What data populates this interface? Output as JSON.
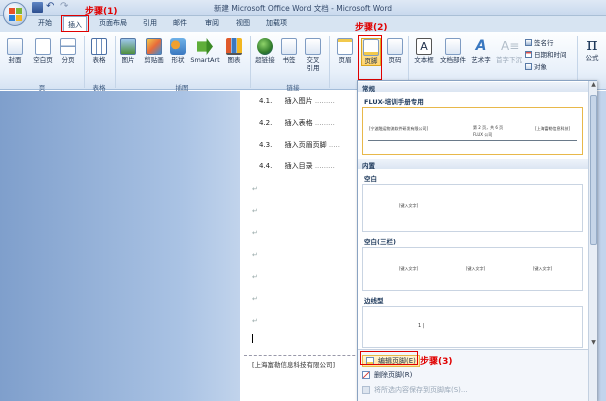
{
  "window": {
    "title": "新建 Microsoft Office Word 文档 - Microsoft Word"
  },
  "tabs": [
    "开始",
    "插入",
    "页面布局",
    "引用",
    "邮件",
    "审阅",
    "视图",
    "加载项"
  ],
  "active_tab": "插入",
  "annotations": {
    "step1": "步骤(1)",
    "step2": "步骤(2)",
    "step3": "步骤(3)"
  },
  "ribbon": {
    "pages": {
      "cover": "封面",
      "blank": "空白页",
      "break": "分页",
      "label": "页"
    },
    "tables": {
      "table": "表格",
      "label": "表格"
    },
    "illustrations": {
      "picture": "图片",
      "clipart": "剪贴画",
      "shapes": "形状",
      "smartart": "SmartArt",
      "chart": "图表",
      "label": "插图"
    },
    "links": {
      "hyperlink": "超链接",
      "bookmark": "书签",
      "crossref_1": "交叉",
      "crossref_2": "引用",
      "label": "链接"
    },
    "header_footer": {
      "header": "页眉",
      "footer": "页脚",
      "pagenum": "页码"
    },
    "text": {
      "textbox": "文本框",
      "quickparts": "文档部件",
      "wordart": "艺术字",
      "dropcap": "首字下沉"
    },
    "misc": {
      "signature": "签名行",
      "datetime": "日期和时间",
      "object": "对象"
    },
    "symbols": {
      "equation": "公式"
    }
  },
  "document": {
    "toc": [
      {
        "num": "4.1.",
        "text": "插入图片"
      },
      {
        "num": "4.2.",
        "text": "插入表格"
      },
      {
        "num": "4.3.",
        "text": "插入页眉页脚"
      },
      {
        "num": "4.4.",
        "text": "插入目录"
      }
    ],
    "footer_text": "[上海富勒信息科技有限公司]"
  },
  "gallery": {
    "section_common": "常规",
    "flux_title": "FLUX-培训手册专用",
    "flux_thumb_left": "[宁波融运物流软件研发有限公司]",
    "flux_thumb_mid": "第 2 页，共 6 页",
    "flux_thumb_mid2": "FLUX 公司",
    "flux_thumb_right": "[上海富勒信息科技]",
    "section_builtin": "内置",
    "blank_title": "空白",
    "blank_thumb": "[键入文字]",
    "blank3_title": "空白(三栏)",
    "blank3_thumb": "[键入文字]",
    "border_title": "边线型",
    "border_thumb": "1 |"
  },
  "menu": {
    "edit_footer": "编辑页脚(E)",
    "remove_footer": "删除页脚(R)",
    "save_to_gallery": "将所选内容保存到页脚库(S)..."
  }
}
